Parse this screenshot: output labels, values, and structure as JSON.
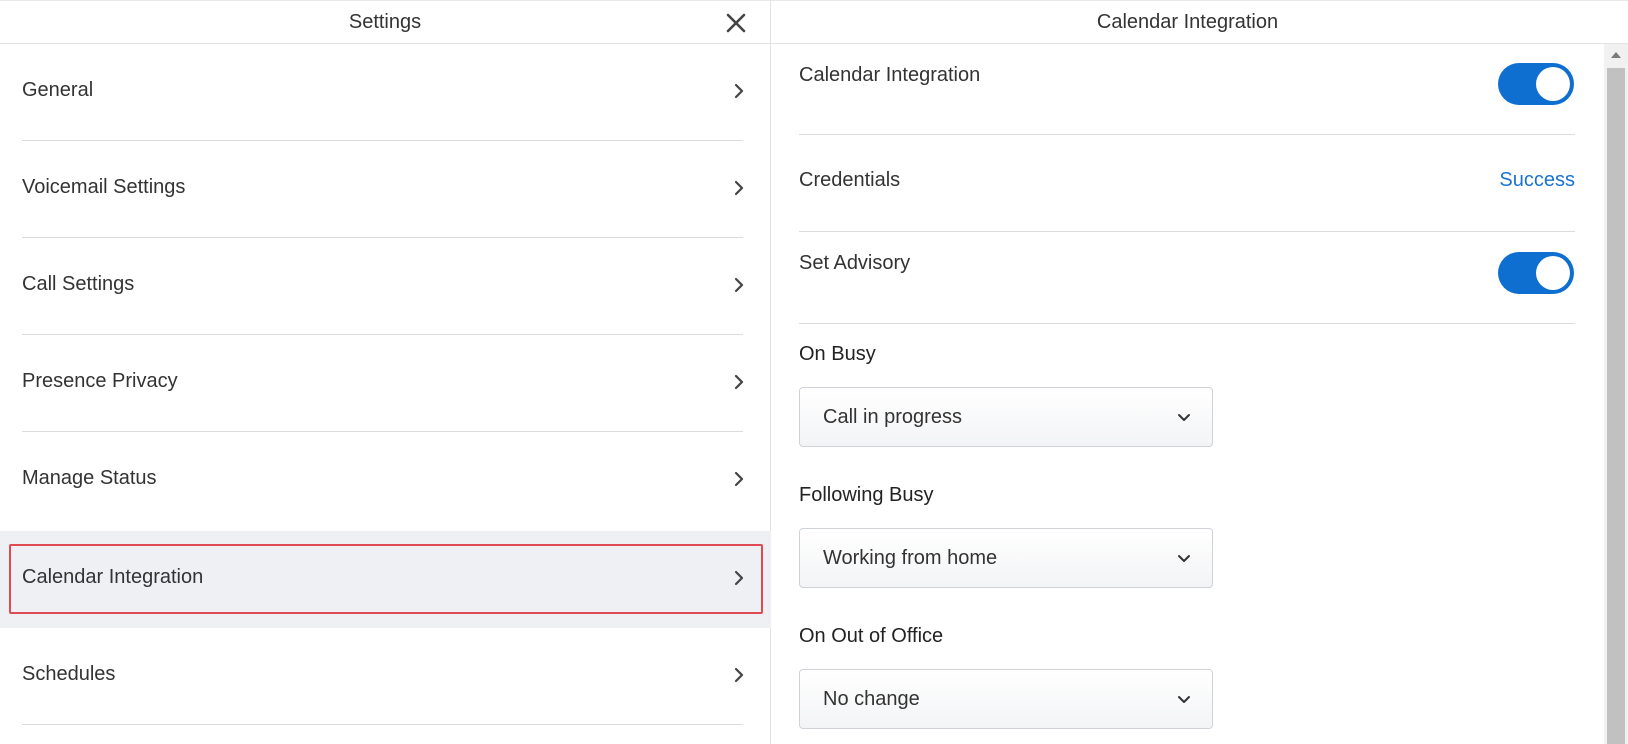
{
  "settings": {
    "title": "Settings",
    "close_icon": "close-icon",
    "items": [
      {
        "label": "General"
      },
      {
        "label": "Voicemail Settings"
      },
      {
        "label": "Call Settings"
      },
      {
        "label": "Presence Privacy"
      },
      {
        "label": "Manage Status"
      },
      {
        "label": "Calendar Integration",
        "selected": true
      },
      {
        "label": "Schedules"
      }
    ]
  },
  "detail": {
    "title": "Calendar Integration",
    "calendar_integration": {
      "label": "Calendar Integration",
      "enabled": true
    },
    "credentials": {
      "label": "Credentials",
      "status": "Success"
    },
    "set_advisory": {
      "label": "Set Advisory",
      "enabled": true
    },
    "on_busy": {
      "label": "On Busy",
      "value": "Call in progress"
    },
    "following_busy": {
      "label": "Following Busy",
      "value": "Working from home"
    },
    "on_out_of_office": {
      "label": "On Out of Office",
      "value": "No change"
    }
  },
  "colors": {
    "accent": "#0f6fd1",
    "link": "#1a73d1",
    "highlight": "#e04a52",
    "selected_bg": "#eef0f3"
  }
}
